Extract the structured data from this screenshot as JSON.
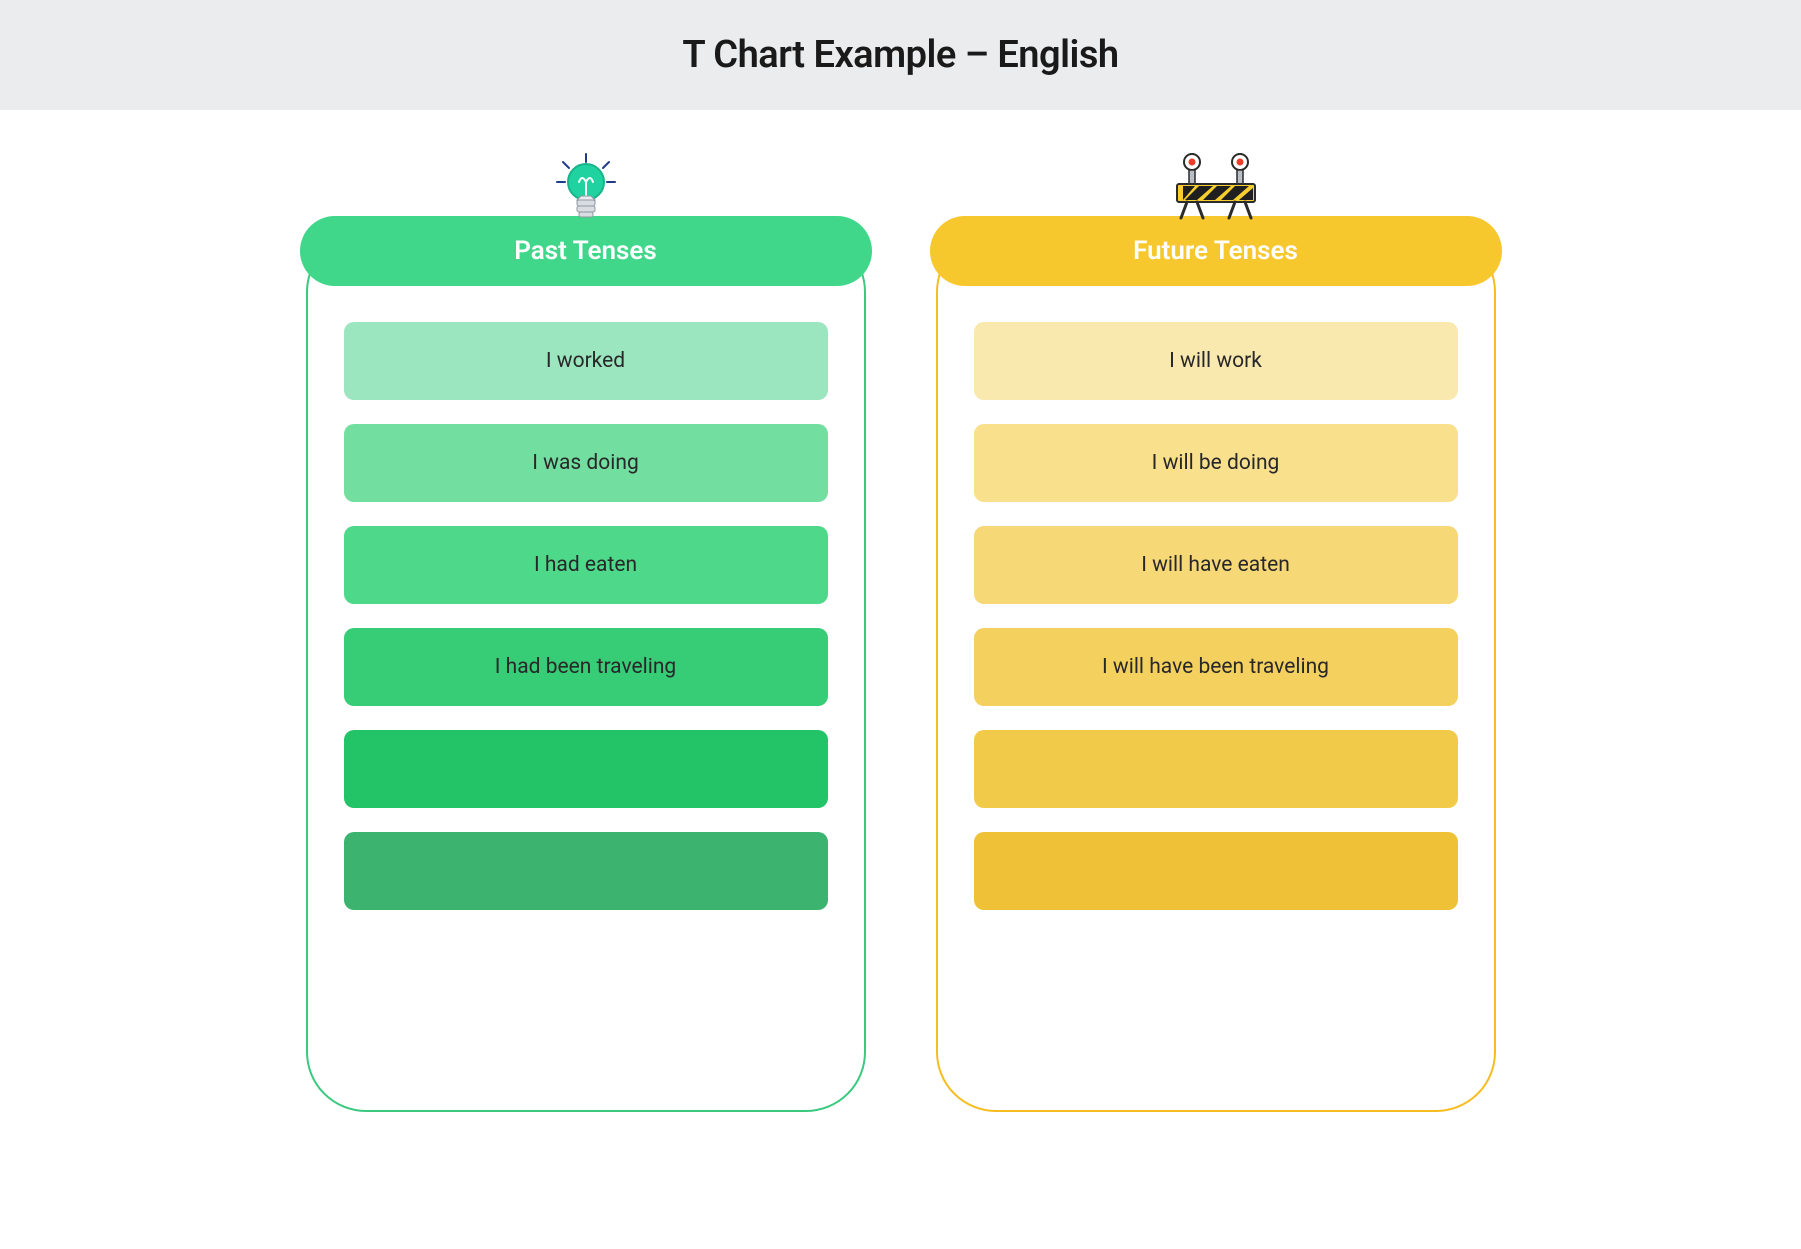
{
  "title": "T Chart Example – English",
  "columns": {
    "left": {
      "header": "Past Tenses",
      "icon": "lightbulb",
      "rows": [
        {
          "text": "I worked",
          "bg": "#9ce6bf"
        },
        {
          "text": "I was doing",
          "bg": "#72de9f"
        },
        {
          "text": "I had eaten",
          "bg": "#4dd989"
        },
        {
          "text": "I had been traveling",
          "bg": "#36cd76"
        },
        {
          "text": "",
          "bg": "#23c367"
        },
        {
          "text": "",
          "bg": "#3cb470"
        }
      ]
    },
    "right": {
      "header": "Future Tenses",
      "icon": "barrier",
      "rows": [
        {
          "text": "I will work",
          "bg": "#f9e9ae"
        },
        {
          "text": "I will be doing",
          "bg": "#f9e08d"
        },
        {
          "text": "I will have eaten",
          "bg": "#f7d877"
        },
        {
          "text": "I will have been traveling",
          "bg": "#f4d15e"
        },
        {
          "text": "",
          "bg": "#f2ca4a"
        },
        {
          "text": "",
          "bg": "#eec137"
        }
      ]
    }
  }
}
